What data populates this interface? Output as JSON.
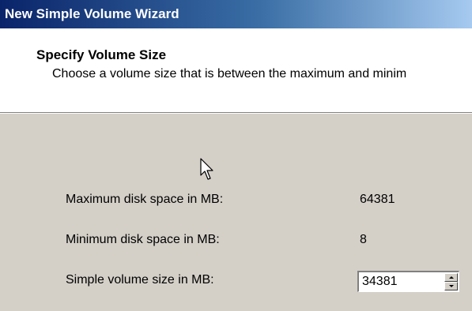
{
  "window": {
    "title": "New Simple Volume Wizard"
  },
  "header": {
    "title": "Specify Volume Size",
    "subtitle": "Choose a volume size that is between the maximum and minim"
  },
  "fields": {
    "max_label": "Maximum disk space in MB:",
    "max_value": "64381",
    "min_label": "Minimum disk space in MB:",
    "min_value": "8",
    "size_label": "Simple volume size in MB:",
    "size_value": "34381"
  },
  "icons": {
    "cursor": "mouse-pointer-icon",
    "spin_up": "spin-up-arrow-icon",
    "spin_down": "spin-down-arrow-icon"
  },
  "colors": {
    "title_bar_start": "#0a246a",
    "title_bar_end": "#a6caf0",
    "dialog_face": "#d4d0c8",
    "header_background": "#ffffff"
  }
}
